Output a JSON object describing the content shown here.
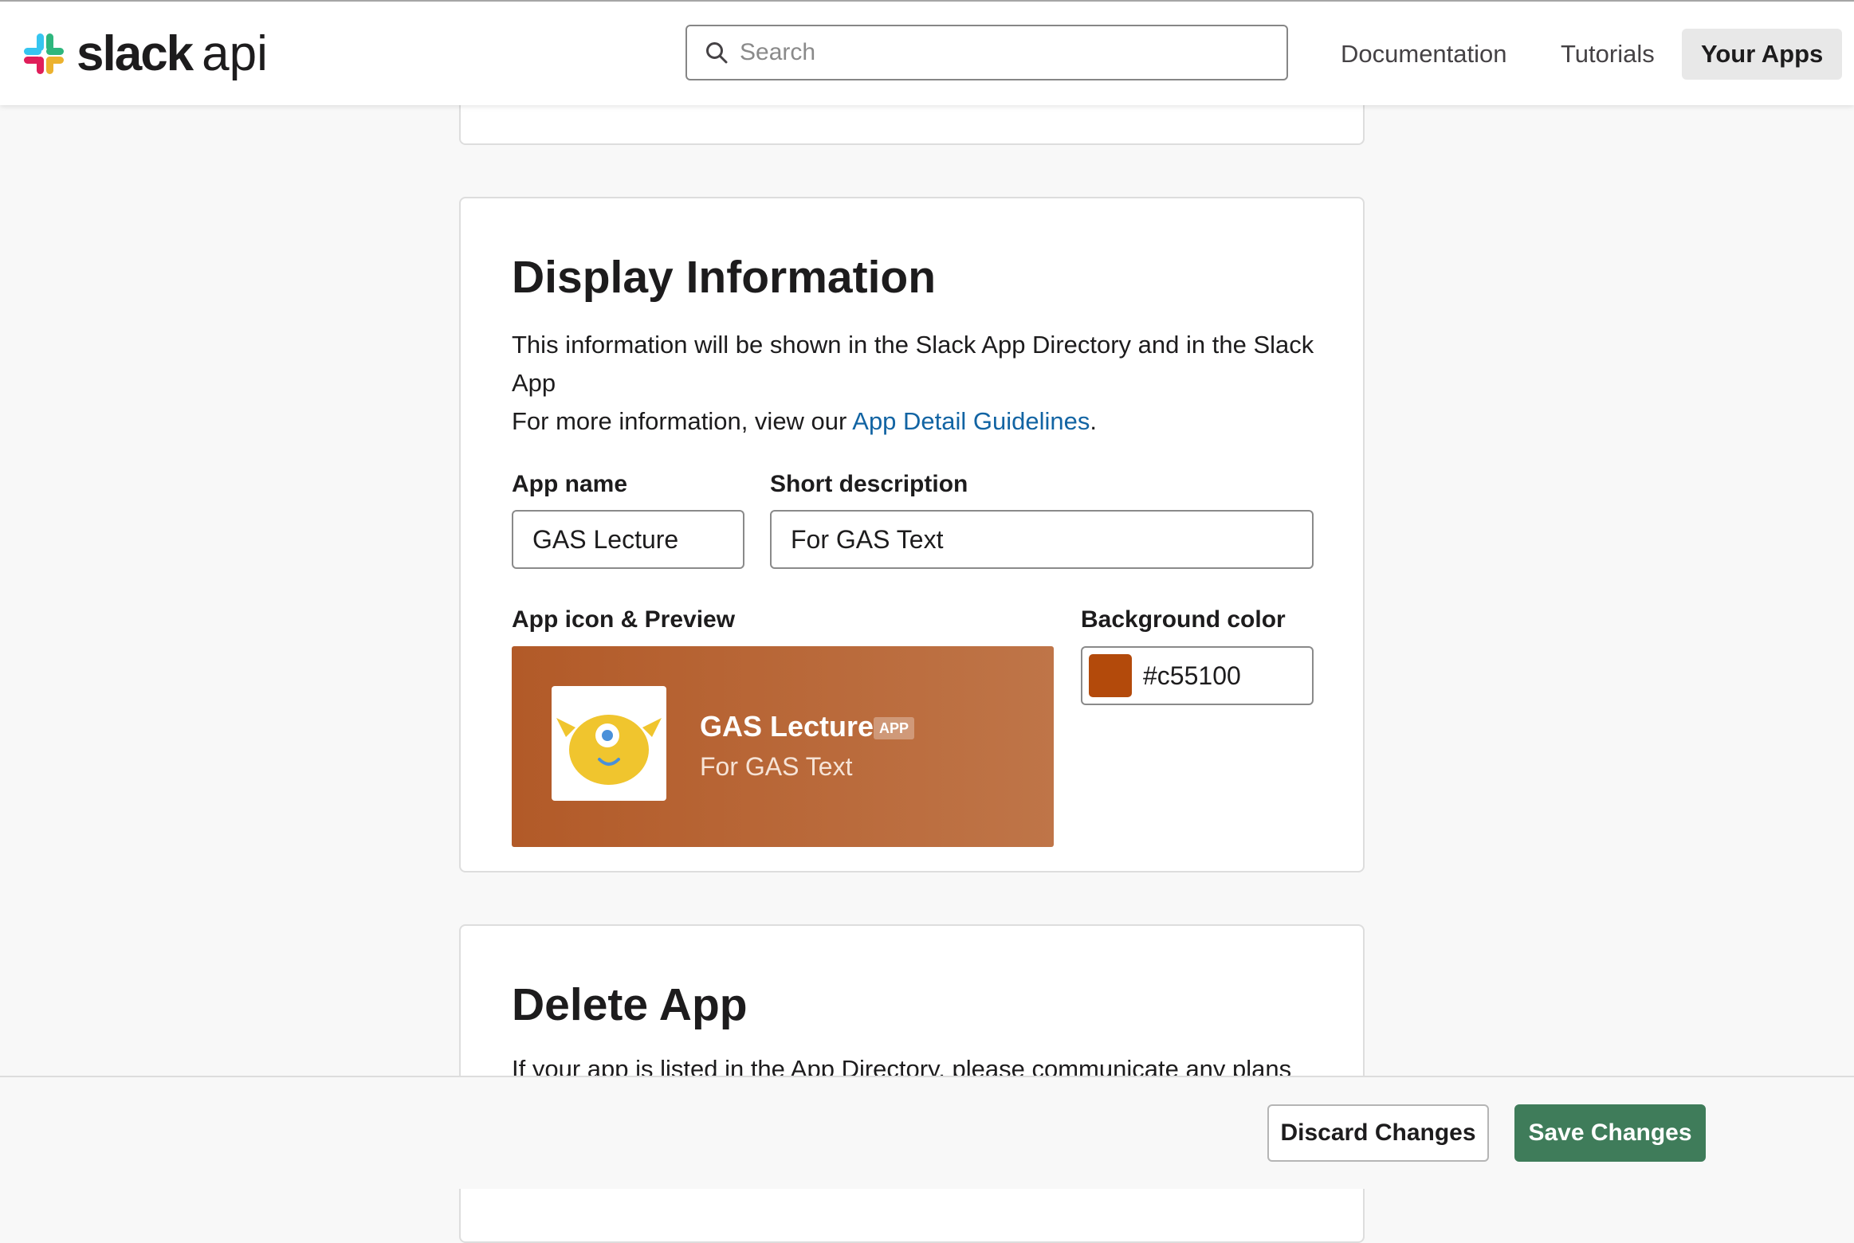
{
  "header": {
    "logo_word": "slack",
    "logo_suffix": "api",
    "search_placeholder": "Search",
    "nav": {
      "documentation": "Documentation",
      "tutorials": "Tutorials",
      "your_apps": "Your Apps"
    }
  },
  "display_info": {
    "title": "Display Information",
    "description_line1": "This information will be shown in the Slack App Directory and in the Slack App",
    "description_prefix": "For more information, view our ",
    "guidelines_link": "App Detail Guidelines",
    "description_suffix": ".",
    "app_name_label": "App name",
    "app_name_value": "GAS Lecture",
    "short_desc_label": "Short description",
    "short_desc_value": "For GAS Text",
    "icon_preview_label": "App icon & Preview",
    "background_color_label": "Background color",
    "background_color_value": "#c55100",
    "preview": {
      "name": "GAS Lecture",
      "badge": "APP",
      "description": "For GAS Text",
      "icon": "yellow-monster-icon"
    }
  },
  "delete_app": {
    "title": "Delete App",
    "description": "If your app is listed in the App Directory, please communicate any plans"
  },
  "footer": {
    "discard_label": "Discard Changes",
    "save_label": "Save Changes"
  },
  "colors": {
    "save_button": "#3f7c5a",
    "link": "#1264a3",
    "preview_start": "#b25a28",
    "preview_end": "#bf7548",
    "swatch": "#b34a0b"
  }
}
